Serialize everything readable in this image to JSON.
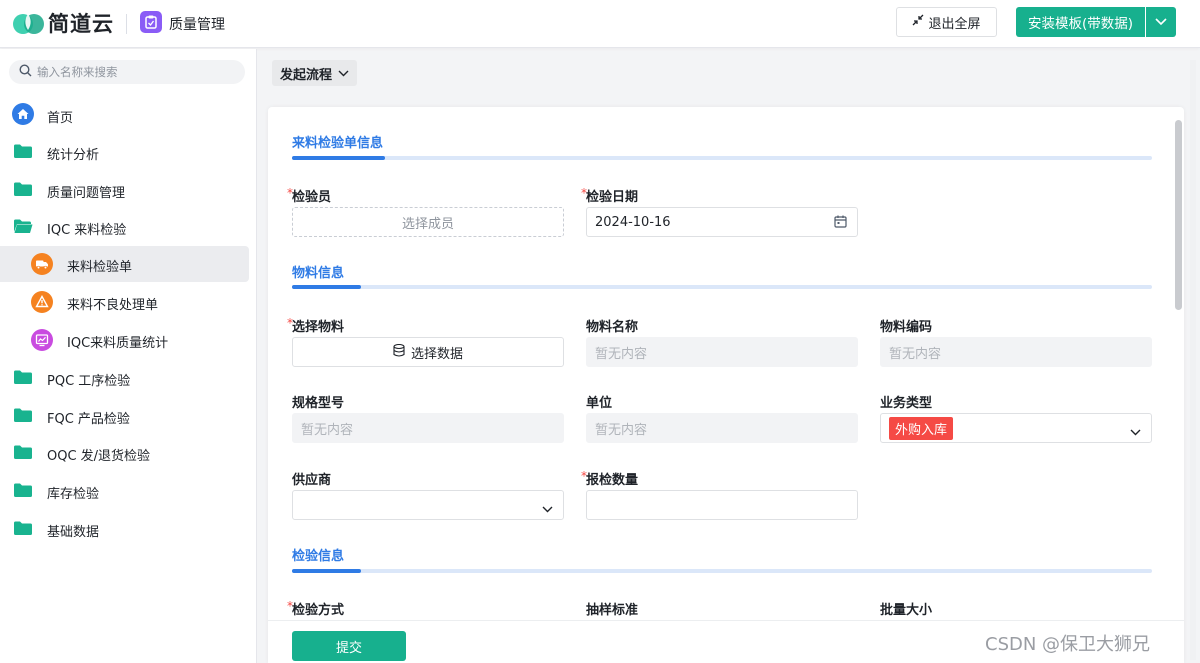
{
  "header": {
    "logo_text": "简道云",
    "app_title": "质量管理",
    "exit_fullscreen_label": "退出全屏",
    "install_label": "安装模板(带数据)"
  },
  "sidebar": {
    "search_placeholder": "输入名称来搜索",
    "items": [
      {
        "label": "首页",
        "icon": "home-icon"
      },
      {
        "label": "统计分析",
        "icon": "folder-icon"
      },
      {
        "label": "质量问题管理",
        "icon": "folder-icon"
      },
      {
        "label": "IQC 来料检验",
        "icon": "folder-open-icon"
      },
      {
        "label": "来料检验单",
        "icon": "truck-icon",
        "color": "#f58220"
      },
      {
        "label": "来料不良处理单",
        "icon": "warning-icon",
        "color": "#f58220"
      },
      {
        "label": "IQC来料质量统计",
        "icon": "chart-icon",
        "color": "#c94be0"
      },
      {
        "label": "PQC 工序检验",
        "icon": "folder-icon"
      },
      {
        "label": "FQC 产品检验",
        "icon": "folder-icon"
      },
      {
        "label": "OQC 发/退货检验",
        "icon": "folder-icon"
      },
      {
        "label": "库存检验",
        "icon": "folder-icon"
      },
      {
        "label": "基础数据",
        "icon": "folder-icon"
      }
    ]
  },
  "toolbar": {
    "start_flow_label": "发起流程"
  },
  "form": {
    "sections": [
      {
        "title": "来料检验单信息"
      },
      {
        "title": "物料信息"
      },
      {
        "title": "检验信息"
      }
    ],
    "fields": {
      "inspector": {
        "label": "检验员",
        "placeholder": "选择成员"
      },
      "inspect_date": {
        "label": "检验日期",
        "value": "2024-10-16"
      },
      "material": {
        "label": "选择物料",
        "button": "选择数据"
      },
      "material_name": {
        "label": "物料名称",
        "placeholder": "暂无内容"
      },
      "material_code": {
        "label": "物料编码",
        "placeholder": "暂无内容"
      },
      "spec": {
        "label": "规格型号",
        "placeholder": "暂无内容"
      },
      "unit": {
        "label": "单位",
        "placeholder": "暂无内容"
      },
      "biz_type": {
        "label": "业务类型",
        "value": "外购入库"
      },
      "supplier": {
        "label": "供应商"
      },
      "qty": {
        "label": "报检数量"
      },
      "method": {
        "label": "检验方式"
      },
      "sampling": {
        "label": "抽样标准"
      },
      "batch": {
        "label": "批量大小"
      }
    },
    "required_mark": "*",
    "submit_label": "提交"
  },
  "watermark": "CSDN @保卫大狮兄",
  "colors": {
    "brand_green": "#17b08e",
    "accent_blue": "#2f7be5",
    "tag_red": "#f54a45"
  }
}
